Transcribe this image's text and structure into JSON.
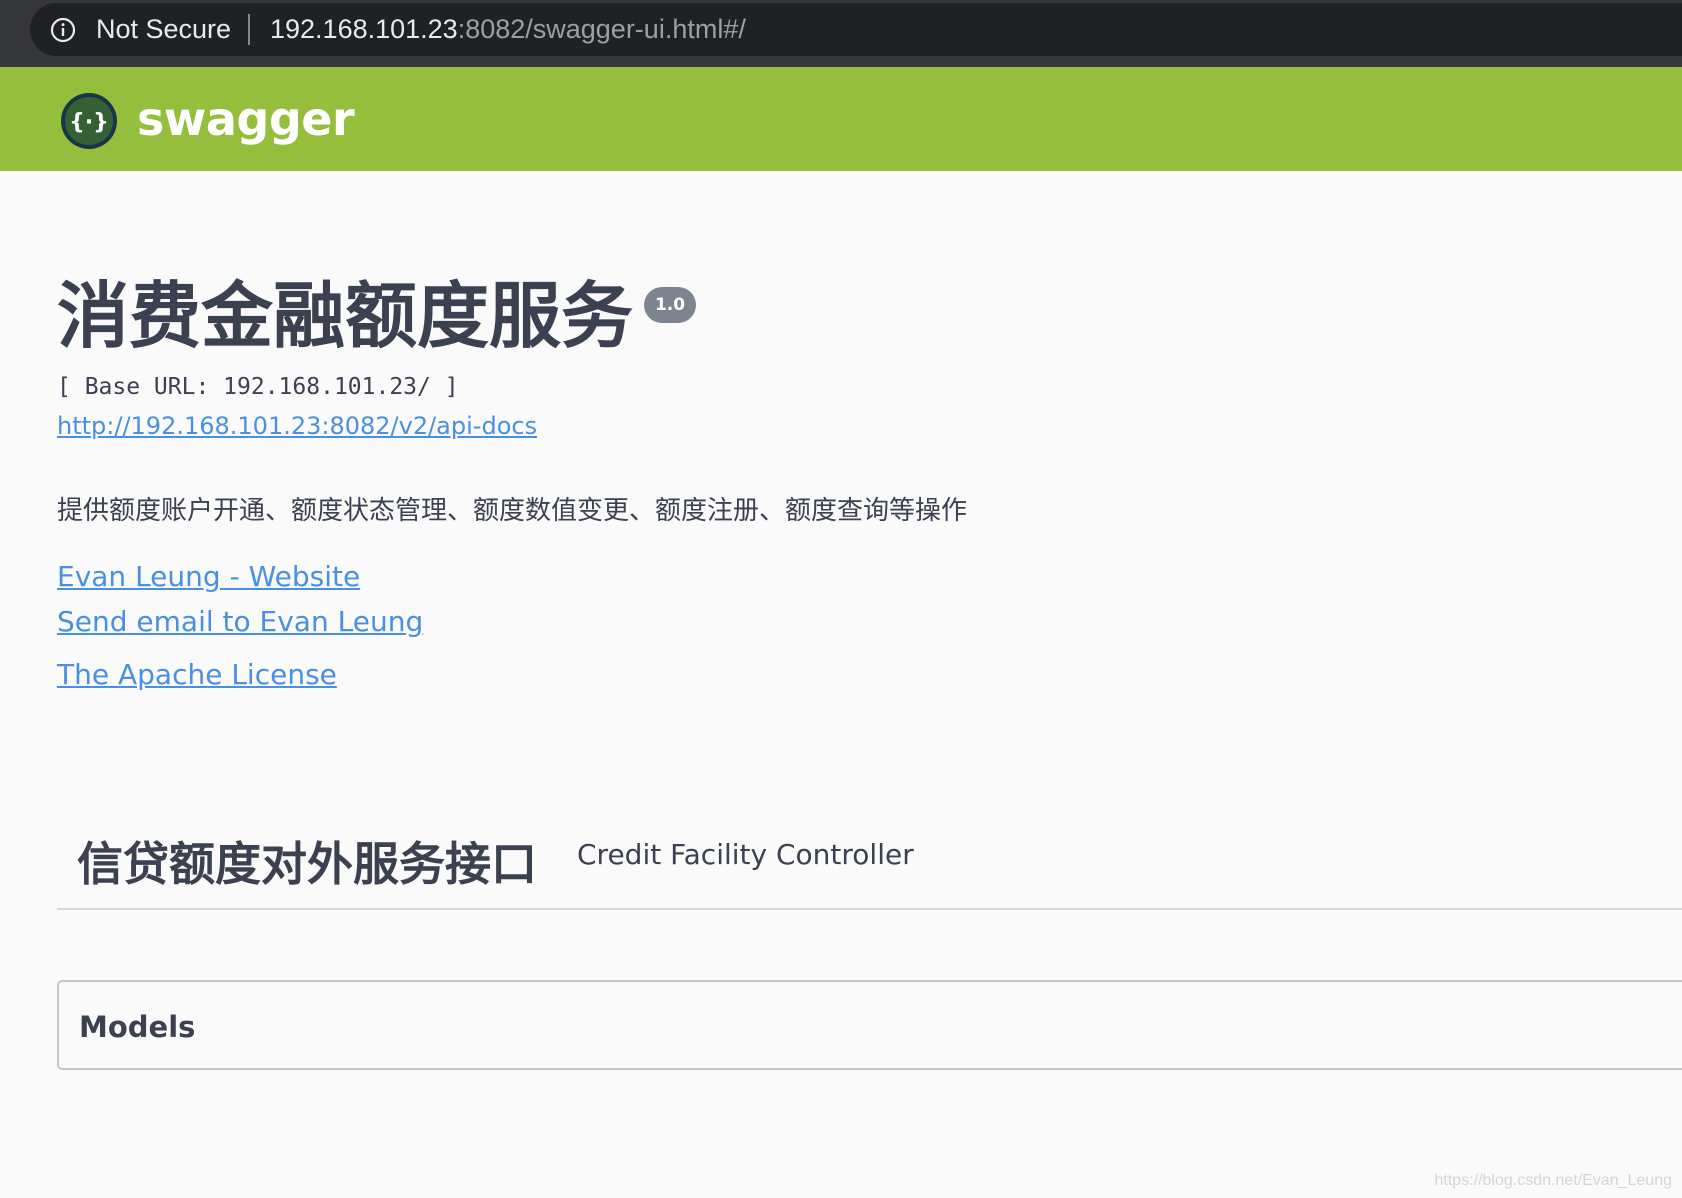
{
  "browser": {
    "security_label": "Not Secure",
    "url_host": "192.168.101.23",
    "url_rest": ":8082/swagger-ui.html#/"
  },
  "topbar": {
    "brand": "swagger",
    "brand_color": "#95be3d"
  },
  "info": {
    "title": "消费金融额度服务",
    "version": "1.0",
    "base_url": "[ Base URL: 192.168.101.23/ ]",
    "api_docs_link": "http://192.168.101.23:8082/v2/api-docs",
    "description": "提供额度账户开通、额度状态管理、额度数值变更、额度注册、额度查询等操作",
    "contact_website": "Evan Leung - Website",
    "contact_email": "Send email to Evan Leung",
    "license": "The Apache License"
  },
  "tag": {
    "name": "信贷额度对外服务接口",
    "description": "Credit Facility Controller"
  },
  "models": {
    "title": "Models"
  },
  "watermark": "https://blog.csdn.net/Evan_Leung",
  "colors": {
    "link": "#4990e2",
    "text": "#3b4151",
    "badge": "#7d8492"
  }
}
